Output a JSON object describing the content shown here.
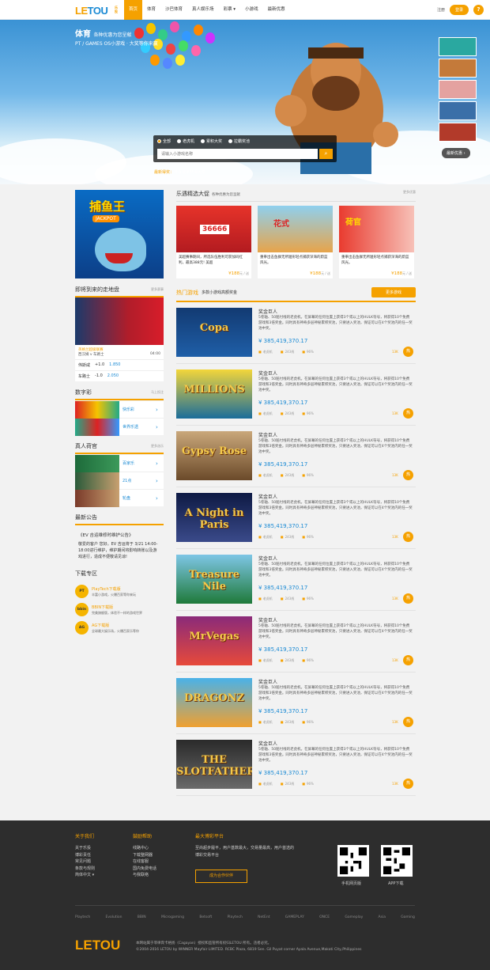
{
  "nav": {
    "logo": {
      "le": "LE",
      "tou": "TOU",
      "tag": "乐投"
    },
    "items": [
      "首页",
      "体育",
      "沙巴体育",
      "真人娱乐场",
      "彩票 ▾",
      "小游戏",
      "最新优惠"
    ],
    "login": "注册",
    "register": "登录",
    "help": "?"
  },
  "hero": {
    "title": "体育",
    "title_sub": "各种优惠为您呈献",
    "subtitle": "PT / GAMES OS小游戏 · 大奖等你来赢",
    "search": {
      "options": [
        "全部",
        "老虎机",
        "累积大奖",
        "拉霸奖池"
      ],
      "placeholder": "请输入小游戏名称",
      "button": "⌕"
    },
    "ticker_label": "最新得奖：",
    "ticker_text": "恭喜玩家获得大奖",
    "latest_btn": "最新优惠 ›"
  },
  "left": {
    "fish": {
      "title": "捕鱼王",
      "jackpot": "JACKPOT"
    },
    "upcoming": {
      "title": "即将到来的走地盘",
      "more": "更多赛事",
      "league": "英格兰超级联赛",
      "teams": "西汉姆 v 车路士",
      "time": "04:00",
      "odds": [
        {
          "team": "伟斯咸",
          "hcap": "+1.0",
          "odd": "1.850"
        },
        {
          "team": "车路士",
          "hcap": "-1.0",
          "odd": "2.050"
        }
      ]
    },
    "lottery": {
      "title": "数字彩",
      "more": "马上投注",
      "items": [
        "快乐彩",
        "世界乐透"
      ]
    },
    "live": {
      "title": "真人荷官",
      "more": "更多选乐",
      "items": [
        "百家乐",
        "21点",
        "轮盘"
      ]
    },
    "notice": {
      "title": "最新公告",
      "heading": "《EV 吉运维修时维护公告》",
      "body": "敬爱的客户 您好。EV 吉运将于 3/21 14:00-18:00进行维护，维护期间将影响转账以及游戏进行，造成不便敬请见谅!"
    },
    "download": {
      "title": "下载专区",
      "items": [
        {
          "icon": "PT",
          "title": "PlayTech下载版",
          "desc": "丰富小游戏，火爆百家等你来玩"
        },
        {
          "icon": "bbin",
          "title": "BBIN下载版",
          "desc": "完美旗舰版，体验不一样的游戏世界"
        },
        {
          "icon": "AG",
          "title": "AG下载版",
          "desc": "全球最大娱乐场，火爆百家乐等你"
        }
      ]
    }
  },
  "right": {
    "promo": {
      "title": "乐遇精选大促",
      "subtitle": "各种优惠为您呈献",
      "more": "更多优惠",
      "items": [
        {
          "text": "美超赛事期间，所选队伍胜利可获加码红利，最高388元! 美超",
          "price": "¥188",
          "unit": "元 / 送"
        },
        {
          "text": "重拳出击鱼群无所遁形轻点捕获深海的蔚蓝风光。",
          "price": "¥188",
          "unit": "元 / 送"
        },
        {
          "text": "重拳出击鱼群无所遁形轻点捕获深海的蔚蓝风光。",
          "price": "¥188",
          "unit": "元 / 送"
        }
      ]
    },
    "hot": {
      "title": "热门游戏",
      "subtitle": "多款小游戏高额奖金",
      "more_btn": "更多游戏",
      "games": [
        {
          "logo": "Copa",
          "name": "奖金巨人",
          "desc": "5卷轴、50赔付线的老虎机。在屏幕的任何位置上获得3个或以上的HULK符号，将获得10个免费游戏和3倍奖金。同时具有神奇多层神秘累积奖池，只要进入奖池，保证可以在4个奖池内的任一奖池中奖。",
          "price": "¥ 385,419,370.17",
          "type": "老虎机",
          "lines": "243线",
          "rate": "96%",
          "count": "13K",
          "badge": "热"
        },
        {
          "logo": "MILLIONS",
          "name": "奖金巨人",
          "desc": "5卷轴、50赔付线的老虎机。在屏幕的任何位置上获得3个或以上的HULK符号，将获得10个免费游戏和3倍奖金。同时具有神奇多层神秘累积奖池，只要进入奖池，保证可以在4个奖池内的任一奖池中奖。",
          "price": "¥ 385,419,370.17",
          "type": "老虎机",
          "lines": "243线",
          "rate": "96%",
          "count": "13K",
          "badge": "热"
        },
        {
          "logo": "Gypsy Rose",
          "name": "奖金巨人",
          "desc": "5卷轴、50赔付线的老虎机。在屏幕的任何位置上获得3个或以上的HULK符号，将获得10个免费游戏和3倍奖金。同时具有神奇多层神秘累积奖池，只要进入奖池，保证可以在4个奖池内的任一奖池中奖。",
          "price": "¥ 385,419,370.17",
          "type": "老虎机",
          "lines": "243线",
          "rate": "96%",
          "count": "13K",
          "badge": "热"
        },
        {
          "logo": "A Night in Paris",
          "name": "奖金巨人",
          "desc": "5卷轴、50赔付线的老虎机。在屏幕的任何位置上获得3个或以上的HULK符号，将获得10个免费游戏和3倍奖金。同时具有神奇多层神秘累积奖池，只要进入奖池，保证可以在4个奖池内的任一奖池中奖。",
          "price": "¥ 385,419,370.17",
          "type": "老虎机",
          "lines": "243线",
          "rate": "96%",
          "count": "13K",
          "badge": "热"
        },
        {
          "logo": "Treasure Nile",
          "name": "奖金巨人",
          "desc": "5卷轴、50赔付线的老虎机。在屏幕的任何位置上获得3个或以上的HULK符号，将获得10个免费游戏和3倍奖金。同时具有神奇多层神秘累积奖池，只要进入奖池，保证可以在4个奖池内的任一奖池中奖。",
          "price": "¥ 385,419,370.17",
          "type": "老虎机",
          "lines": "243线",
          "rate": "96%",
          "count": "13K",
          "badge": "热"
        },
        {
          "logo": "MrVegas",
          "name": "奖金巨人",
          "desc": "5卷轴、50赔付线的老虎机。在屏幕的任何位置上获得3个或以上的HULK符号，将获得10个免费游戏和3倍奖金。同时具有神奇多层神秘累积奖池，只要进入奖池，保证可以在4个奖池内的任一奖池中奖。",
          "price": "¥ 385,419,370.17",
          "type": "老虎机",
          "lines": "243线",
          "rate": "96%",
          "count": "13K",
          "badge": "热"
        },
        {
          "logo": "DRAGONZ",
          "name": "奖金巨人",
          "desc": "5卷轴、50赔付线的老虎机。在屏幕的任何位置上获得3个或以上的HULK符号，将获得10个免费游戏和3倍奖金。同时具有神奇多层神秘累积奖池，只要进入奖池，保证可以在4个奖池内的任一奖池中奖。",
          "price": "¥ 385,419,370.17",
          "type": "老虎机",
          "lines": "243线",
          "rate": "96%",
          "count": "13K",
          "badge": "热"
        },
        {
          "logo": "THE SLOTFATHER",
          "name": "奖金巨人",
          "desc": "5卷轴、50赔付线的老虎机。在屏幕的任何位置上获得3个或以上的HULK符号，将获得10个免费游戏和3倍奖金。同时具有神奇多层神秘累积奖池，只要进入奖池，保证可以在4个奖池内的任一奖池中奖。",
          "price": "¥ 385,419,370.17",
          "type": "老虎机",
          "lines": "243线",
          "rate": "96%",
          "count": "13K",
          "badge": "热"
        }
      ]
    }
  },
  "footer": {
    "about": {
      "title": "关于我们",
      "links": [
        "关于乐投",
        "博彩责任",
        "常见问题",
        "条款与规则",
        "简体中文 ▾"
      ]
    },
    "help": {
      "title": "鼓励帮助",
      "links": [
        "线路中心",
        "下载整网器",
        "在线客服",
        "国内免费电话",
        "与我联络"
      ]
    },
    "platform": {
      "title": "最大博彩平台",
      "text": "至尚超步履平，用户基数最大，交易量最高，用户首选的博彩交易平台",
      "button": "成为合作伙伴"
    },
    "qr": [
      "手机网页版",
      "APP下载"
    ],
    "brands": [
      "Playtech",
      "Evolution",
      "BBIN",
      "Microgaming",
      "Betsoft",
      "Playtech",
      "NetEnt",
      "GAMEPLAY",
      "ONCE",
      "Gameplay",
      "Asia",
      "Gaming"
    ],
    "logo": "LETOU",
    "legal1": "本网站属于菲律宾卡格扬（Cagayan）授权和监管所有权归LETOU 所有。违者必究。",
    "legal2": "©2004-2016 LETOU by WINNER Mayfair LIMITED. RCBC Plaza, 6819 Sen. Gil Puyat corner Ayala Avenue,Makati City,Philippines"
  }
}
